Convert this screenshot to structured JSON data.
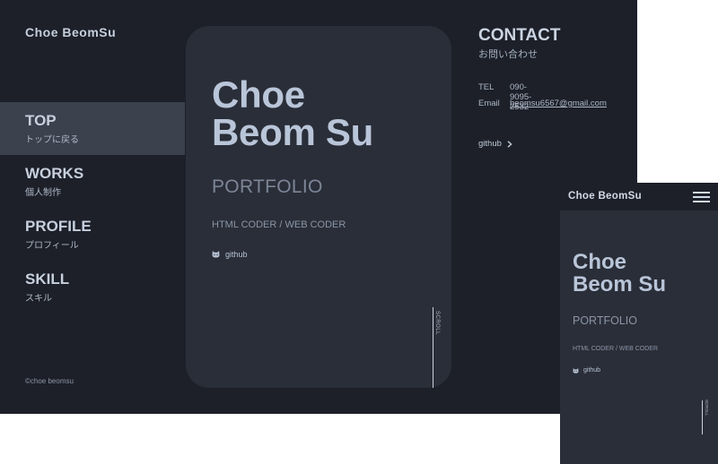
{
  "desktop": {
    "logo": "Choe BeomSu",
    "nav": [
      {
        "label": "TOP",
        "sub": "トップに戻る"
      },
      {
        "label": "WORKS",
        "sub": "個人制作"
      },
      {
        "label": "PROFILE",
        "sub": "プロフィール"
      },
      {
        "label": "SKILL",
        "sub": "スキル"
      }
    ],
    "copyright": "©choe beomsu",
    "card": {
      "name_line1": "Choe",
      "name_line2": "Beom Su",
      "portfolio": "PORTFOLIO",
      "role": "HTML CODER / WEB CODER",
      "github": "github",
      "github_icon": "github-cat-icon",
      "scroll": "SCROLL"
    },
    "contact": {
      "title": "CONTACT",
      "subtitle": "お問い合わせ",
      "tel_label": "TEL",
      "tel_value": "090-9095-2532",
      "email_label": "Email",
      "email_value": "beomsu6567@gmail.com",
      "github": "github",
      "github_arrow": "›"
    }
  },
  "mobile": {
    "logo": "Choe BeomSu",
    "menu_icon": "hamburger-icon",
    "name_line1": "Choe",
    "name_line2": "Beom Su",
    "portfolio": "PORTFOLIO",
    "role": "HTML CODER / WEB CODER",
    "github": "github",
    "scroll": "SCROLL"
  },
  "colors": {
    "background": "#1d2029",
    "card": "#2a2e38",
    "nav_active": "#3b414d",
    "text": "#b9c5d8"
  }
}
